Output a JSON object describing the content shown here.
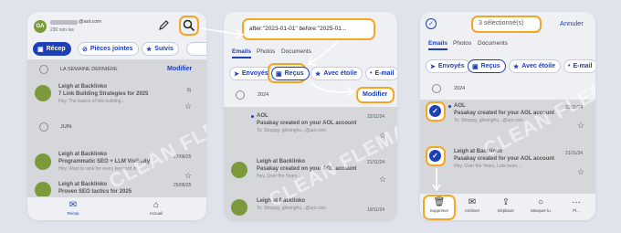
{
  "panel1": {
    "avatar_initials": "GA",
    "email": "@aol.com",
    "unread_count": "230 non lus",
    "chips": [
      {
        "label": "Récep",
        "icon": "inbox-icon",
        "active": true
      },
      {
        "label": "Pièces jointes",
        "icon": "paperclip-icon",
        "active": false
      },
      {
        "label": "Suivis",
        "icon": "star-icon",
        "active": false
      }
    ],
    "section_label": "LA SEMAINE DERNIÈRE",
    "modify_label": "Modifier",
    "section2_label": "JUIN",
    "rows": [
      {
        "title": "Leigh at Backlinko",
        "subject": "7 Link Building Strategies for 2025",
        "preview": "Hey, The basics of link building...",
        "date": "6j"
      },
      {
        "title": "Leigh at Backlinko",
        "subject": "Programmatic SEO + LLM Visibility",
        "preview": "Hey, Want to rank for every keyword in...",
        "date": "27/06/25"
      },
      {
        "title": "Leigh at Backlinko",
        "subject": "Proven SEO tactics for 2025",
        "preview": "Hey, Here's what works now...",
        "date": "25/06/25"
      }
    ],
    "nav": [
      {
        "label": "Récep",
        "icon": "mail-icon"
      },
      {
        "label": "Accueil",
        "icon": "home-icon"
      }
    ],
    "watermark": "CLEAN FLEMAIL"
  },
  "panel2": {
    "search_query": "after:\"2023-01-01\" before:\"2025-01...",
    "tabs": [
      "Emails",
      "Photos",
      "Documents"
    ],
    "chips": [
      {
        "label": "Envoyés",
        "icon": "send-icon",
        "active": false
      },
      {
        "label": "Reçus",
        "icon": "inbox-icon",
        "active": true
      },
      {
        "label": "Avec étoile",
        "icon": "star-icon",
        "active": false
      },
      {
        "label": "E-mail",
        "icon": "dot-icon",
        "active": false
      }
    ],
    "year_label": "2024",
    "modify_label": "Modifier",
    "rows": [
      {
        "title": "AOL",
        "subject": "Pasakay created on your AOL account",
        "preview": "To: Stroppy, glksmghu...@aol.com",
        "date": "22/11/24"
      },
      {
        "title": "Leigh at Backlinko",
        "subject": "Pasakay created on your AOL account",
        "preview": "Hey, Over the Years...",
        "date": "21/11/24"
      },
      {
        "title": "Leigh at Backlinko",
        "subject": "Pasakay created on your AOL account",
        "preview": "To: Stroppy, glksmghu...@aol.com",
        "date": "19/11/24"
      }
    ],
    "watermark": "CLEAN FLEMAIL"
  },
  "panel3": {
    "selection_label": "3 sélectionné(s)",
    "cancel_label": "Annuler",
    "tabs": [
      "Emails",
      "Photos",
      "Documents"
    ],
    "chips": [
      {
        "label": "Envoyés",
        "icon": "send-icon",
        "active": false
      },
      {
        "label": "Reçus",
        "icon": "inbox-icon",
        "active": true
      },
      {
        "label": "Avec étoile",
        "icon": "star-icon",
        "active": false
      },
      {
        "label": "E-mail",
        "icon": "dot-icon",
        "active": false
      }
    ],
    "year_label": "2024",
    "rows": [
      {
        "title": "AOL",
        "subject": "Pasakay created for your AOL account",
        "preview": "To: Stroppy, glksmghu...@aol.com",
        "date": "22/11/24"
      },
      {
        "title": "Leigh at Backlinko",
        "subject": "Pasakay created for your AOL account",
        "preview": "Hey, Over the Years, Lots been...",
        "date": "21/11/24"
      }
    ],
    "actions": [
      {
        "label": "Supprimer",
        "icon": "trash-icon"
      },
      {
        "label": "Archiver",
        "icon": "archive-icon"
      },
      {
        "label": "Déplacer",
        "icon": "move-icon"
      },
      {
        "label": "Marquer lu",
        "icon": "circle-icon"
      },
      {
        "label": "Pl...",
        "icon": "more-icon"
      }
    ],
    "watermark": "CLEAN FLEMAIL"
  },
  "colors": {
    "accent": "#1f3fb5",
    "highlight": "#f5a623",
    "avatar_green": "#7c9a3c",
    "background": "#dfe3ec"
  }
}
